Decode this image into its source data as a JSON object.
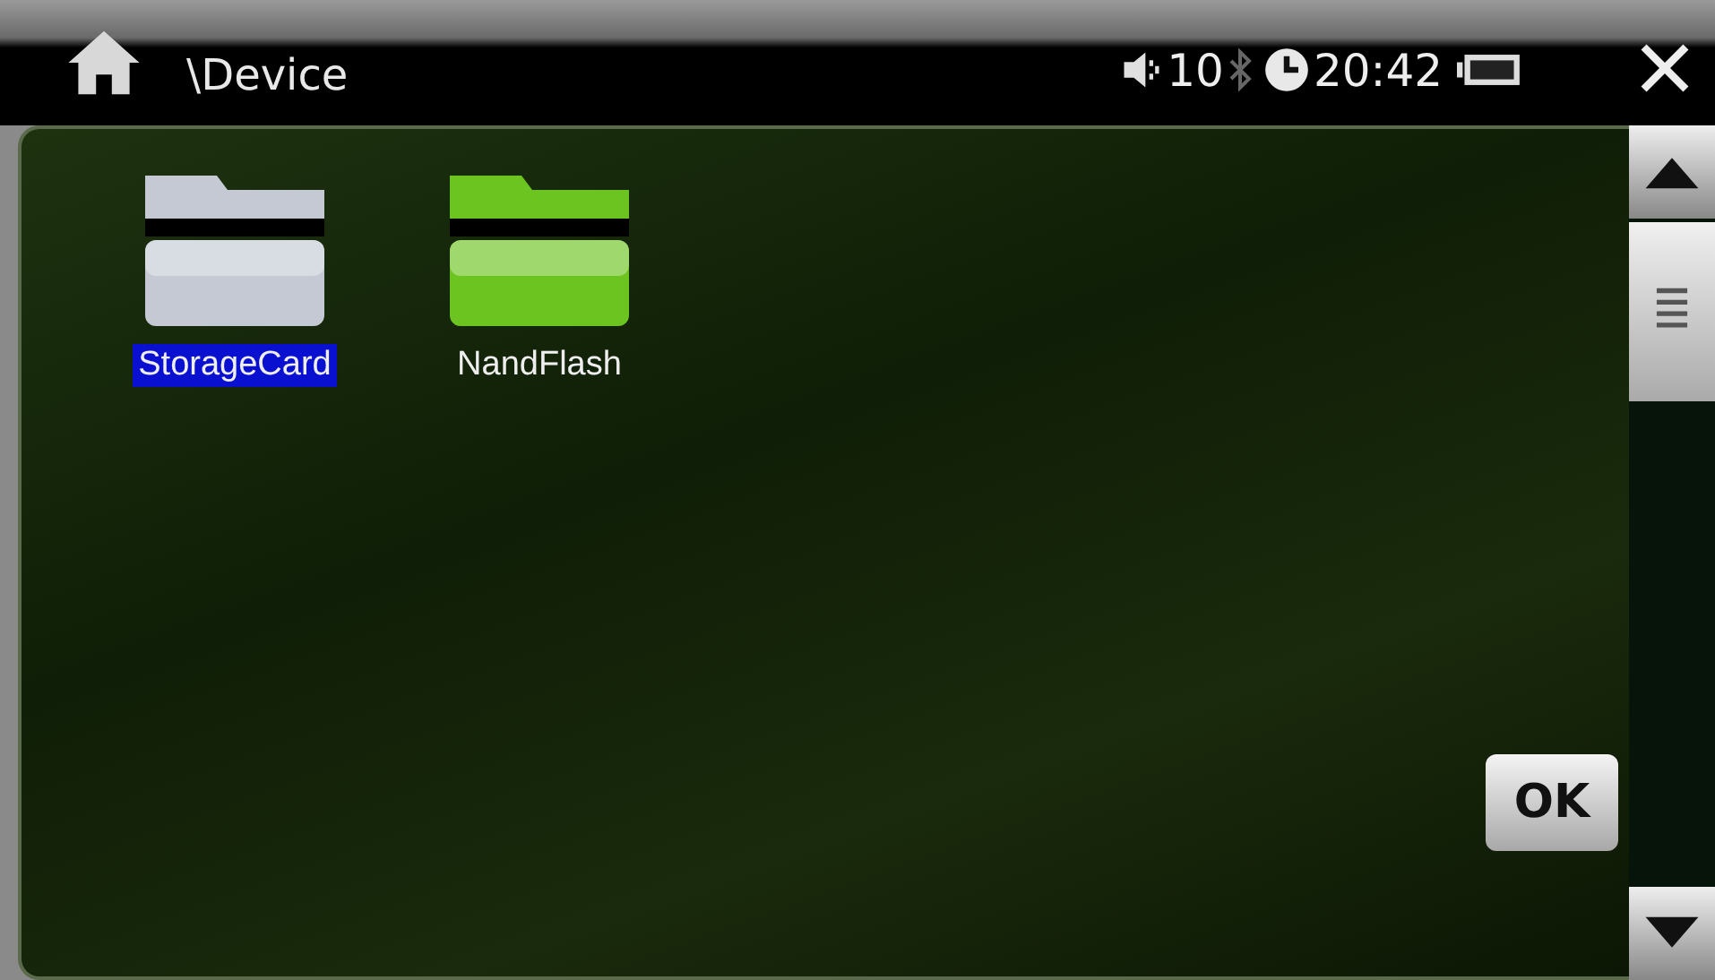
{
  "title_bar": {
    "path": "\\Device",
    "volume": "10",
    "bluetooth_on": false,
    "time": "20:42"
  },
  "folders": [
    {
      "name": "StorageCard",
      "selected": true,
      "color": "#c4c9d4"
    },
    {
      "name": "NandFlash",
      "selected": false,
      "color": "#6cc420"
    }
  ],
  "ok_button": "OK"
}
